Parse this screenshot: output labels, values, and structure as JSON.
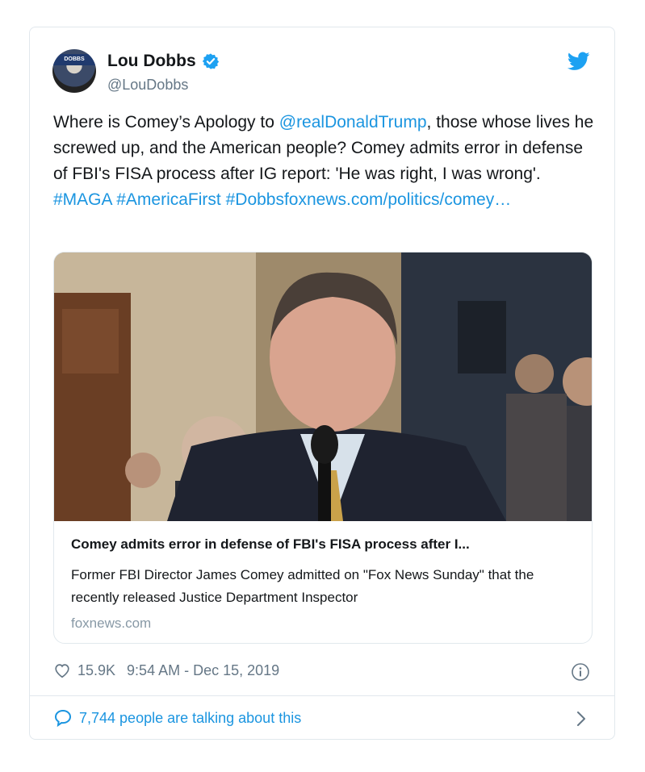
{
  "author": {
    "display_name": "Lou Dobbs",
    "handle": "@LouDobbs",
    "avatar_banner_text": "DOBBS",
    "verified_icon": "verified-badge-icon",
    "platform_icon": "twitter-bird-icon"
  },
  "tweet": {
    "text_1": "Where is Comey’s Apology to ",
    "mention": "@realDonaldTrump",
    "text_2": ", those whose lives he screwed up, and the American people?  Comey admits error in defense of FBI's FISA process after IG report: 'He was right, I was wrong'. ",
    "hashtag_1": "#MAGA",
    "hashtag_2": "#AmericaFirst",
    "hashtag_3_link": "#Dobbsfoxnews.com/politics/comey…"
  },
  "link_card": {
    "title": "Comey admits error in defense of FBI's FISA process after I...",
    "description": "Former FBI Director James Comey admitted on \"Fox News Sunday\" that the recently released Justice Department Inspector",
    "domain": "foxnews.com"
  },
  "meta": {
    "likes": "15.9K",
    "timestamp": "9:54 AM - Dec 15, 2019"
  },
  "footer": {
    "talking_text": "7,744 people are talking about this"
  },
  "colors": {
    "link": "#1b95e0",
    "muted": "#657786",
    "border": "#e1e8ed"
  }
}
